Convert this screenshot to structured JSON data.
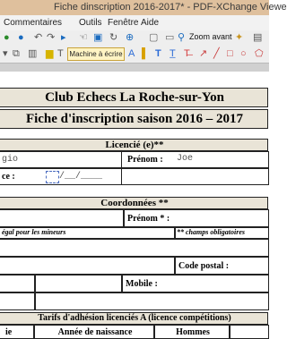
{
  "window": {
    "title": "Fiche dinscription 2016-2017* - PDF-XChange Viewer"
  },
  "menu": {
    "items": [
      "Commentaires",
      "Outils",
      "Fenêtre",
      "Aide"
    ]
  },
  "toolbar": {
    "zoom_label": "Zoom avant",
    "typewriter_label": "Machine à écrire"
  },
  "form": {
    "club": "Club Echecs La Roche-sur-Yon",
    "fiche": "Fiche d'inscription saison 2016 – 2017",
    "licencie_header": "Licencié (e)**",
    "nom_value": "gio",
    "prenom_label": "Prénom :",
    "prenom_value": "Joe",
    "naissance_label": "ce :",
    "naissance_value": "/__/____",
    "coord_header": "Coordonnées **",
    "prenom2_label": "Prénom * :",
    "legal_note": "égal pour les mineurs",
    "oblig_note": "** champs obligatoires",
    "code_postal_label": "Code postal :",
    "mobile_label": "Mobile :",
    "tarifs_header": "Tarifs d'adhésion licenciés A (licence compétitions)",
    "col1": "ie",
    "col2": "Année de naissance",
    "col3": "Hommes"
  }
}
